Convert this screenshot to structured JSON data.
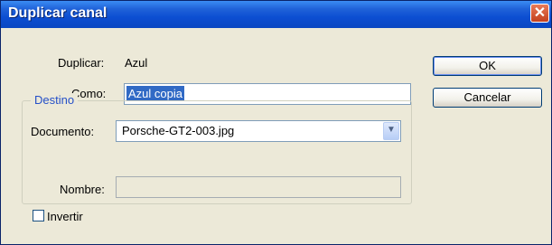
{
  "dialog": {
    "title": "Duplicar canal"
  },
  "duplicate": {
    "label": "Duplicar:",
    "value": "Azul"
  },
  "as": {
    "label": "Como:",
    "value": "Azul copia"
  },
  "destination": {
    "legend": "Destino",
    "document_label": "Documento:",
    "document_value": "Porsche-GT2-003.jpg",
    "name_label": "Nombre:",
    "name_value": "",
    "invert_label": "Invertir",
    "invert_checked": false
  },
  "buttons": {
    "ok": "OK",
    "cancel": "Cancelar"
  },
  "colors": {
    "titlebar": "#0c4ed2",
    "dialog_bg": "#ece9d8",
    "selection": "#316ac5",
    "legend": "#2550c8"
  }
}
